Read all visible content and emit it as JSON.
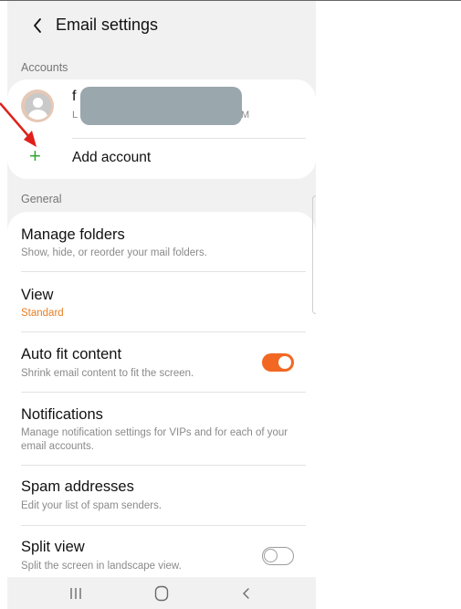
{
  "header": {
    "title": "Email settings"
  },
  "accounts": {
    "section_label": "Accounts",
    "account": {
      "name_visible": "f",
      "detail_start": "L",
      "detail_end": "M"
    },
    "add_account_label": "Add account"
  },
  "general": {
    "section_label": "General",
    "items": [
      {
        "title": "Manage folders",
        "subtitle": "Show, hide, or reorder your mail folders."
      },
      {
        "title": "View",
        "subtitle": "Standard"
      },
      {
        "title": "Auto fit content",
        "subtitle": "Shrink email content to fit the screen.",
        "toggle": true
      },
      {
        "title": "Notifications",
        "subtitle": "Manage notification settings for VIPs and for each of your email accounts."
      },
      {
        "title": "Spam addresses",
        "subtitle": "Edit your list of spam senders."
      },
      {
        "title": "Split view",
        "subtitle": "Split the screen in landscape view.",
        "toggle": false
      }
    ]
  },
  "colors": {
    "accent_orange": "#f26722",
    "add_green": "#3aa639",
    "annotation_red": "#e0201b"
  },
  "icons": [
    "back-chevron-icon",
    "avatar-icon",
    "plus-icon",
    "recents-icon",
    "home-icon",
    "nav-back-icon"
  ]
}
